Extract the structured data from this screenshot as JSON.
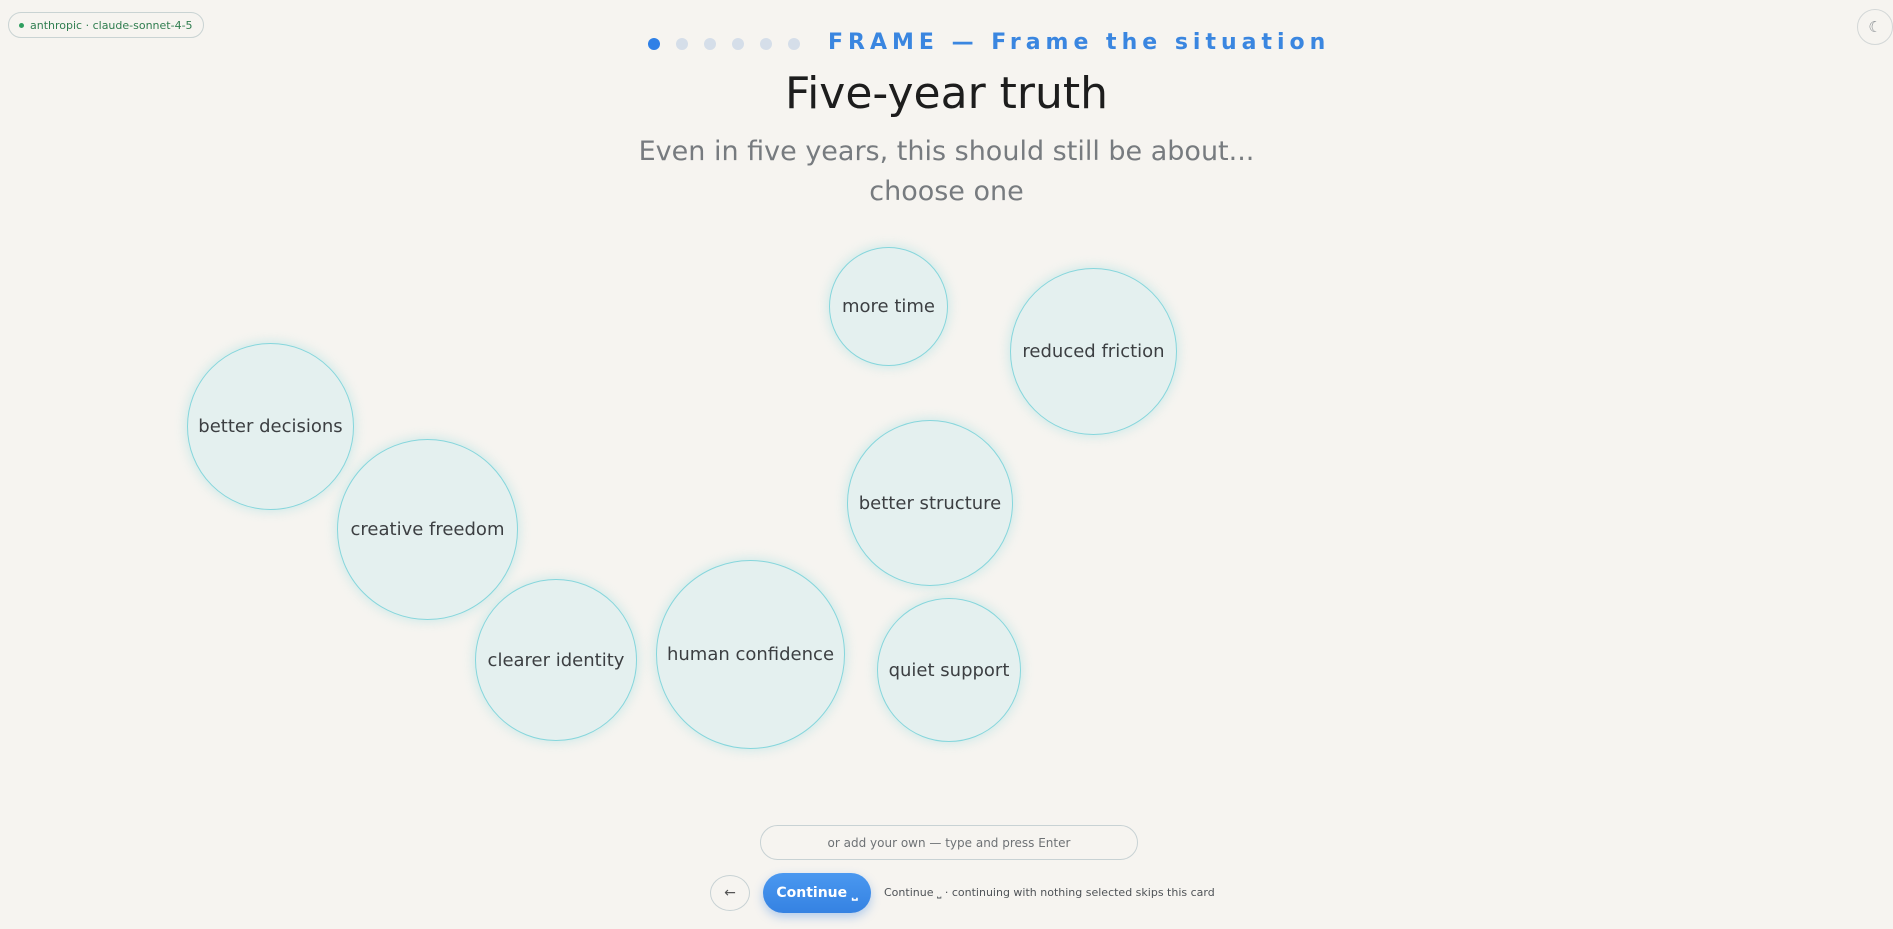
{
  "model_badge": {
    "label": "anthropic · claude-sonnet-4-5"
  },
  "theme_toggle": {
    "icon": "moon-icon",
    "glyph": "☾"
  },
  "progress": {
    "current_step": 1,
    "total_steps": 6
  },
  "step_label": "FRAME — Frame the situation",
  "title": "Five-year truth",
  "subtitle_line1": "Even in five years, this should still be about...",
  "subtitle_line2": "choose one",
  "options": [
    "more time",
    "reduced friction",
    "better decisions",
    "creative freedom",
    "better structure",
    "clearer identity",
    "human confidence",
    "quiet support"
  ],
  "custom_input": {
    "placeholder": "or add your own — type and press Enter",
    "value": ""
  },
  "back_button": {
    "icon": "arrow-left-icon",
    "glyph": "←"
  },
  "continue_button": {
    "label": "Continue ⎵"
  },
  "hint": "Continue ⎵ · continuing with nothing selected skips this card",
  "colors": {
    "accent": "#3a86e0",
    "bubble_fill": "#e4f0ef",
    "bubble_border": "#86d6dc",
    "background": "#f6f4f0"
  }
}
